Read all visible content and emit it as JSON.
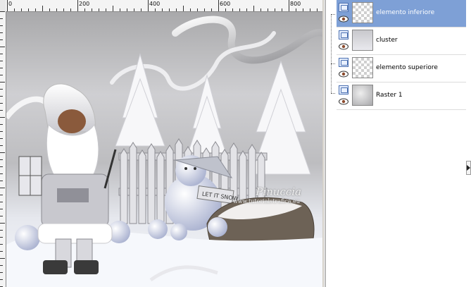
{
  "ruler": {
    "labels": [
      "0",
      "200",
      "400",
      "600",
      "800"
    ]
  },
  "watermark": {
    "name": "Pinuccia",
    "site": "www.tutorialstrafica.eu"
  },
  "layers": [
    {
      "name": "elemento inferiore",
      "selected": true,
      "thumb": "transparent"
    },
    {
      "name": "cluster",
      "selected": false,
      "thumb": "cluster"
    },
    {
      "name": "elemento superiore",
      "selected": false,
      "thumb": "transparent"
    },
    {
      "name": "Raster 1",
      "selected": false,
      "thumb": "raster"
    }
  ],
  "colors": {
    "selected_layer": "#7ea0d6",
    "ruler_bg": "#f4f4f4"
  }
}
